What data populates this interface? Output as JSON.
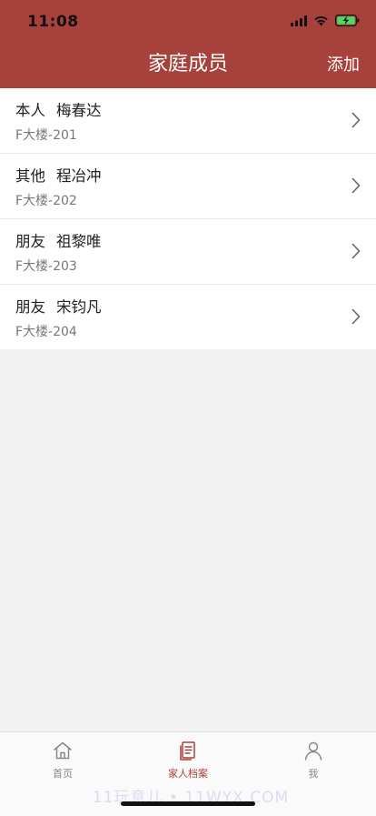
{
  "status_bar": {
    "time": "11:08",
    "signal_icon": "cellular-signal-icon",
    "wifi_icon": "wifi-icon",
    "battery_icon": "battery-charging-icon"
  },
  "header": {
    "title": "家庭成员",
    "add_label": "添加",
    "background_color": "#a6413b"
  },
  "members": [
    {
      "relation": "本人",
      "name": "梅春达",
      "address": "F大楼-201"
    },
    {
      "relation": "其他",
      "name": "程冶冲",
      "address": "F大楼-202"
    },
    {
      "relation": "朋友",
      "name": "祖黎唯",
      "address": "F大楼-203"
    },
    {
      "relation": "朋友",
      "name": "宋钧凡",
      "address": "F大楼-204"
    }
  ],
  "tabbar": {
    "tabs": [
      {
        "label": "首页",
        "icon": "home-icon",
        "active": false
      },
      {
        "label": "家人档案",
        "icon": "document-icon",
        "active": true
      },
      {
        "label": "我",
        "icon": "person-icon",
        "active": false
      }
    ],
    "active_color": "#a6413b",
    "inactive_color": "#888888"
  },
  "watermark": {
    "text": "11玩意儿 • 11WYX.COM"
  }
}
